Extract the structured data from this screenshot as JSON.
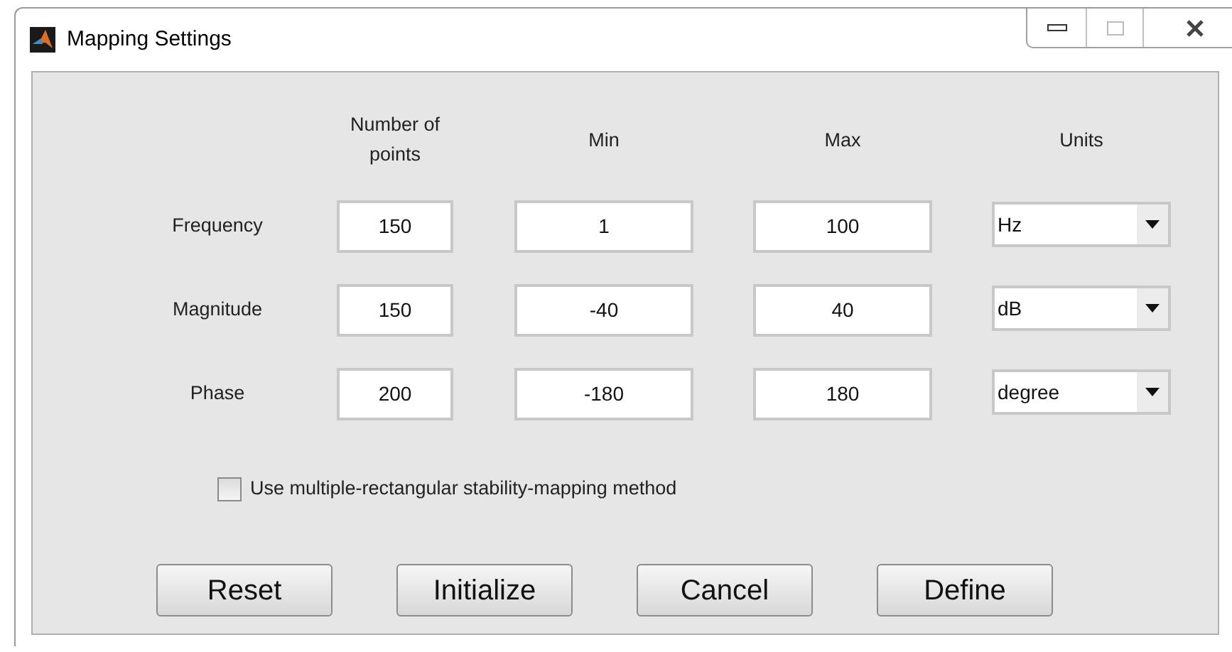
{
  "window": {
    "title": "Mapping Settings"
  },
  "columns": [
    "Number of points",
    "Min",
    "Max",
    "Units"
  ],
  "rows": [
    {
      "label": "Frequency",
      "points": "150",
      "min": "1",
      "max": "100",
      "units": "Hz"
    },
    {
      "label": "Magnitude",
      "points": "150",
      "min": "-40",
      "max": "40",
      "units": "dB"
    },
    {
      "label": "Phase",
      "points": "200",
      "min": "-180",
      "max": "180",
      "units": "degree"
    }
  ],
  "option": {
    "label": "Use multiple-rectangular stability-mapping method",
    "checked": false
  },
  "buttons": [
    "Reset",
    "Initialize",
    "Cancel",
    "Define"
  ]
}
